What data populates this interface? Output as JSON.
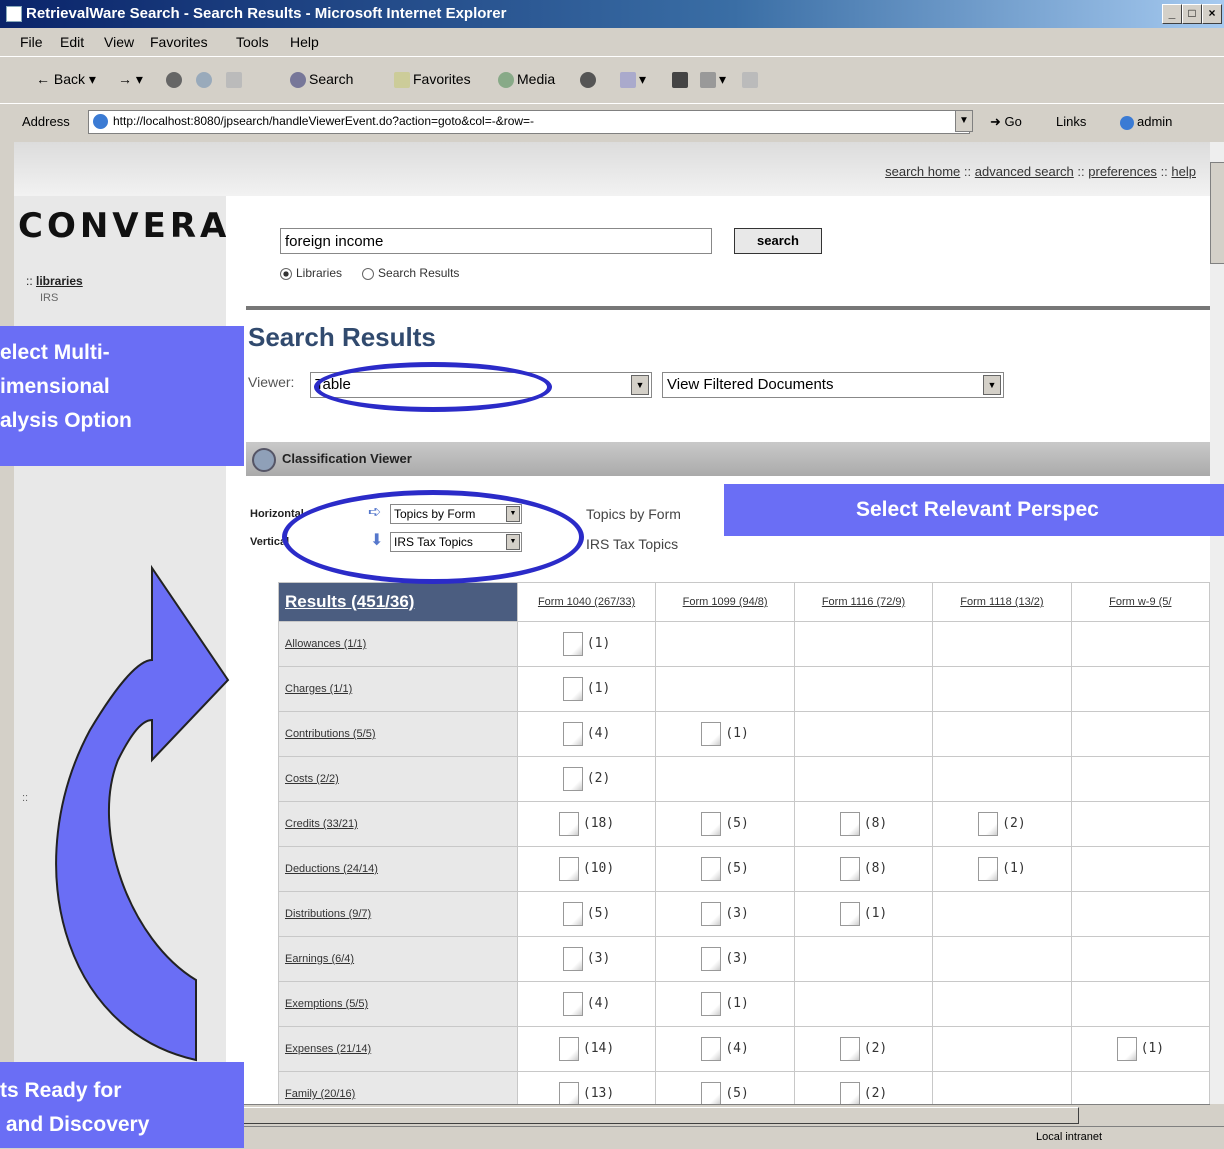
{
  "window": {
    "title": "RetrievalWare Search - Search Results - Microsoft Internet Explorer",
    "min": "_",
    "max": "□",
    "close": "×"
  },
  "menu": [
    "File",
    "Edit",
    "View",
    "Favorites",
    "Tools",
    "Help"
  ],
  "toolbar": {
    "back": "Back",
    "search": "Search",
    "favorites": "Favorites",
    "media": "Media"
  },
  "address": {
    "label": "Address",
    "url": "http://localhost:8080/jpsearch/handleViewerEvent.do?action=goto&col=-&row=-",
    "go": "Go",
    "links": "Links",
    "admin": "admin"
  },
  "top_links": {
    "search_home": "search home",
    "sep": "::",
    "advanced_search": "advanced search",
    "preferences": "preferences",
    "help": "help"
  },
  "sidebar": {
    "logo": "CONVERA",
    "libraries": "libraries",
    "library_item": "IRS",
    "marker": "::"
  },
  "search": {
    "query": "foreign income",
    "button": "search",
    "radio_libraries": "Libraries",
    "radio_results": "Search Results"
  },
  "results": {
    "title": "Search Results",
    "viewer_label": "Viewer:",
    "viewer_value": "Table",
    "filter_value": "View Filtered Documents"
  },
  "classification": {
    "title": "Classification Viewer",
    "horizontal_label": "Horizontal",
    "vertical_label": "Vertical",
    "horizontal_select": "Topics by Form",
    "vertical_select": "IRS Tax Topics",
    "horizontal_text": "Topics by Form",
    "vertical_text": "IRS Tax Topics"
  },
  "table": {
    "corner": "Results (451/36)",
    "columns": [
      "Form 1040 (267/33)",
      "Form 1099 (94/8)",
      "Form 1116 (72/9)",
      "Form 1118 (13/2)",
      "Form w-9 (5/"
    ],
    "rows": [
      {
        "label": "Allowances (1/1)",
        "cells": [
          "(1)",
          "",
          "",
          "",
          ""
        ]
      },
      {
        "label": "Charges (1/1)",
        "cells": [
          "(1)",
          "",
          "",
          "",
          ""
        ]
      },
      {
        "label": "Contributions (5/5)",
        "cells": [
          "(4)",
          "(1)",
          "",
          "",
          ""
        ]
      },
      {
        "label": "Costs (2/2)",
        "cells": [
          "(2)",
          "",
          "",
          "",
          ""
        ]
      },
      {
        "label": "Credits (33/21)",
        "cells": [
          "(18)",
          "(5)",
          "(8)",
          "(2)",
          ""
        ]
      },
      {
        "label": "Deductions (24/14)",
        "cells": [
          "(10)",
          "(5)",
          "(8)",
          "(1)",
          ""
        ]
      },
      {
        "label": "Distributions (9/7)",
        "cells": [
          "(5)",
          "(3)",
          "(1)",
          "",
          ""
        ]
      },
      {
        "label": "Earnings (6/4)",
        "cells": [
          "(3)",
          "(3)",
          "",
          "",
          ""
        ]
      },
      {
        "label": "Exemptions (5/5)",
        "cells": [
          "(4)",
          "(1)",
          "",
          "",
          ""
        ]
      },
      {
        "label": "Expenses (21/14)",
        "cells": [
          "(14)",
          "(4)",
          "(2)",
          "",
          "(1)"
        ]
      },
      {
        "label": "Family (20/16)",
        "cells": [
          "(13)",
          "(5)",
          "(2)",
          "",
          ""
        ]
      }
    ]
  },
  "status": {
    "zone": "Local intranet"
  },
  "callouts": {
    "multi": "elect Multi-\nimensional\nalysis Option",
    "perspective": "Select Relevant Perspec",
    "ready": "ts Ready for\n and Discovery"
  },
  "colors": {
    "callout": "#6a6ef5",
    "ellipse": "#2b2bc8",
    "table_header": "#4b5d80",
    "title": "#314a6e"
  }
}
